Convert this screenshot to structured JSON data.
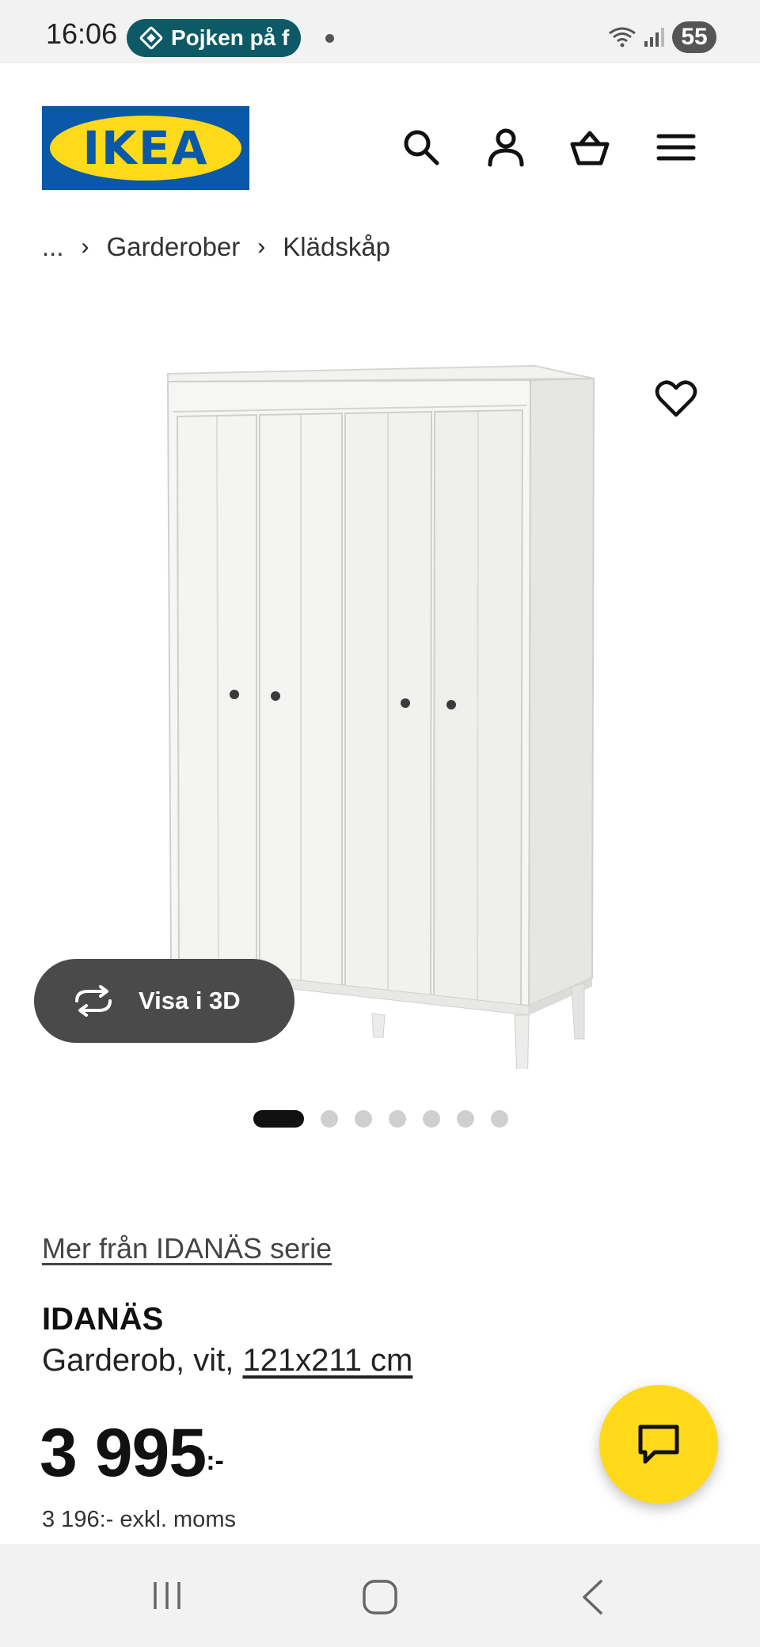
{
  "status_bar": {
    "time": "16:06",
    "notification_pill": "Pojken på f",
    "battery": "55",
    "icons": [
      "navigation-icon",
      "wifi-icon",
      "signal-icon",
      "battery-icon"
    ]
  },
  "header": {
    "logo_text": "IKEA",
    "brand_colors": {
      "blue": "#0a58a8",
      "yellow": "#ffda1a"
    },
    "icons": [
      "search-icon",
      "account-icon",
      "basket-icon",
      "menu-icon"
    ]
  },
  "breadcrumb": {
    "items": [
      "...",
      "Garderober",
      "Klädskåp"
    ],
    "separator": "›"
  },
  "gallery": {
    "view_3d_label": "Visa i 3D",
    "slide_count": 7,
    "active_slide": 1,
    "image_alt": "white wardrobe"
  },
  "product": {
    "series_link": "Mer från IDANÄS serie",
    "name": "IDANÄS",
    "description_prefix": "Garderob, vit, ",
    "dimensions": "121x211 cm",
    "price": "3 995",
    "price_suffix": ":-",
    "price_excl_vat": "3 196:- exkl. moms"
  },
  "chat": {
    "icon": "chat-icon",
    "color": "#ffd91a"
  },
  "nav_bar": {
    "icons": [
      "recent-apps-icon",
      "home-icon",
      "back-icon"
    ]
  }
}
